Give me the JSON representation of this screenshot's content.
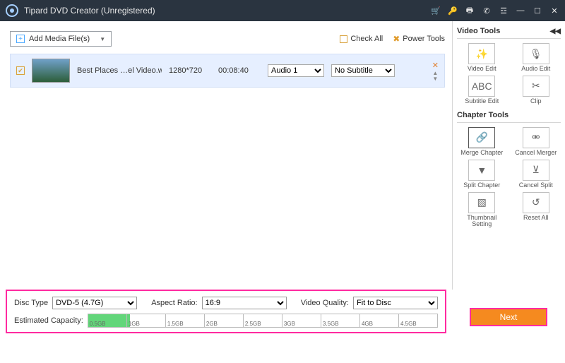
{
  "titlebar": {
    "title": "Tipard DVD Creator (Unregistered)"
  },
  "toolbar": {
    "add_media_label": "Add Media File(s)",
    "check_all_label": "Check All",
    "power_tools_label": "Power Tools"
  },
  "media_row": {
    "filename": "Best Places …el Video.wmv",
    "resolution": "1280*720",
    "duration": "00:08:40",
    "audio_selected": "Audio 1",
    "subtitle_selected": "No Subtitle"
  },
  "video_tools": {
    "title": "Video Tools",
    "items": [
      {
        "label": "Video Edit",
        "icon": "✨"
      },
      {
        "label": "Audio Edit",
        "icon": "🎙"
      },
      {
        "label": "Subtitle Edit",
        "icon": "ABC"
      },
      {
        "label": "Clip",
        "icon": "✂"
      }
    ]
  },
  "chapter_tools": {
    "title": "Chapter Tools",
    "items": [
      {
        "label": "Merge Chapter",
        "icon": "🔗"
      },
      {
        "label": "Cancel Merger",
        "icon": "⚮"
      },
      {
        "label": "Split Chapter",
        "icon": "▼"
      },
      {
        "label": "Cancel Split",
        "icon": "⊻"
      },
      {
        "label": "Thumbnail Setting",
        "icon": "▧"
      },
      {
        "label": "Reset All",
        "icon": "↺"
      }
    ]
  },
  "settings": {
    "disc_type_label": "Disc Type",
    "disc_type_value": "DVD-5 (4.7G)",
    "aspect_label": "Aspect Ratio:",
    "aspect_value": "16:9",
    "quality_label": "Video Quality:",
    "quality_value": "Fit to Disc",
    "capacity_label": "Estimated Capacity:",
    "ticks": [
      "0.5GB",
      "1GB",
      "1.5GB",
      "2GB",
      "2.5GB",
      "3GB",
      "3.5GB",
      "4GB",
      "4.5GB"
    ]
  },
  "next_label": "Next"
}
